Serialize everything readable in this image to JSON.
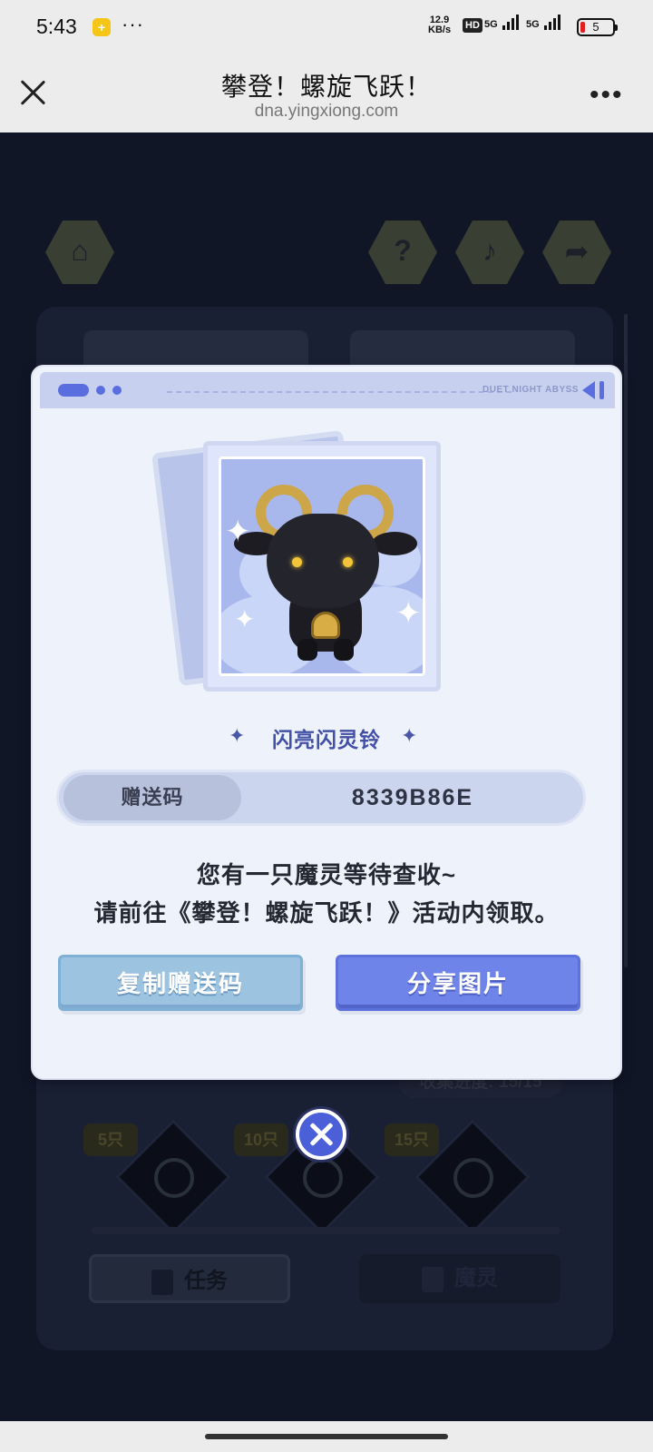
{
  "status_bar": {
    "time": "5:43",
    "more": "···",
    "net_speed_value": "12.9",
    "net_speed_unit": "KB/s",
    "hd_badge": "HD",
    "signal1": "5G",
    "signal2": "5G",
    "battery": "5"
  },
  "browser": {
    "title": "攀登！螺旋飞跃！",
    "url": "dna.yingxiong.com",
    "more": "•••"
  },
  "background": {
    "count_text": "收集进度: 15/15",
    "milestones": [
      "5只",
      "10只",
      "15只"
    ],
    "task_button": "任务",
    "spirit_button": "魔灵"
  },
  "dialog": {
    "header_text": "DUET NIGHT ABYSS",
    "item_name": "闪亮闪灵铃",
    "code_label": "赠送码",
    "code_value": "8339B86E",
    "message_line1": "您有一只魔灵等待查收~",
    "message_line2": "请前往《攀登！螺旋飞跃！》活动内领取。",
    "copy_button": "复制赠送码",
    "share_button": "分享图片"
  },
  "colors": {
    "accent": "#6f84e8",
    "copy_button": "#9cc3e0",
    "dialog_bg": "#eef2fa",
    "item_name": "#4250a6"
  }
}
